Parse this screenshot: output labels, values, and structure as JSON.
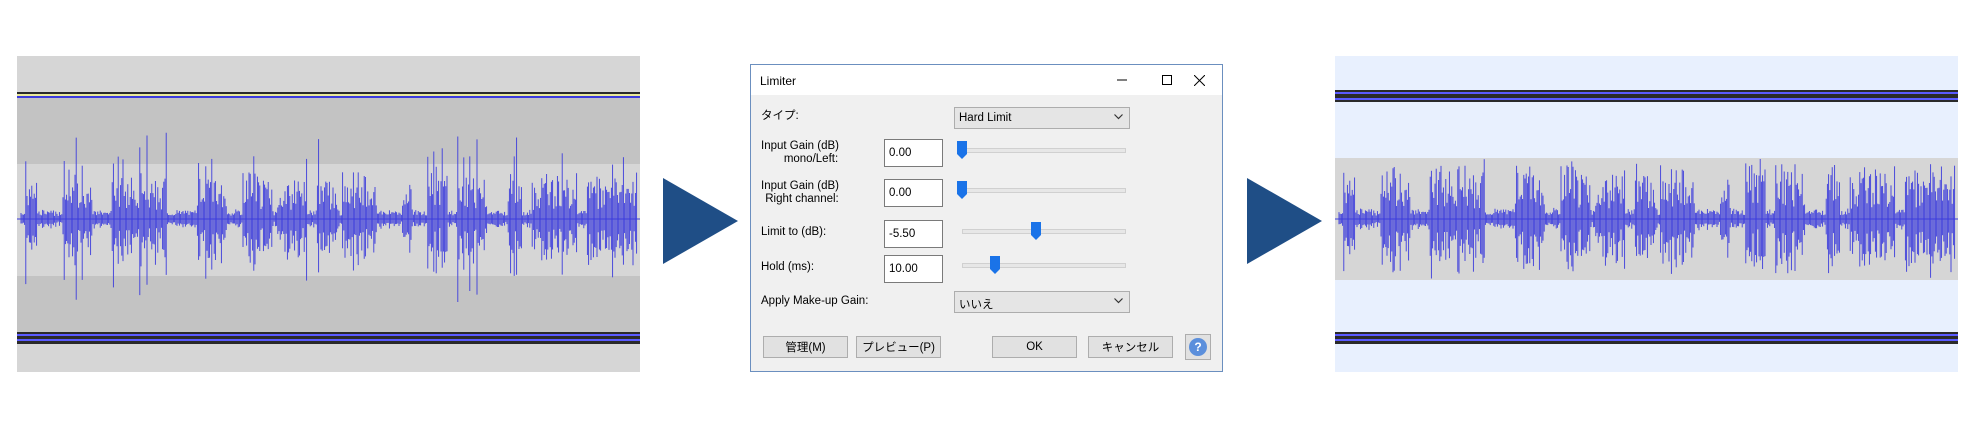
{
  "colors": {
    "waveform": "#3c3cdc",
    "arrow": "#1f4e86",
    "track_bg_original": "#d6d6d6",
    "track_band_original": "#c3c3c3",
    "track_bg_processed": "#e8f0fe",
    "track_band_processed": "#d6d6d6",
    "slider_thumb": "#1a73e8"
  },
  "icons": {
    "arrow": "triangle-right",
    "minimize": "minimize-icon",
    "maximize": "maximize-icon",
    "close": "close-icon",
    "help": "help-icon"
  },
  "dialog": {
    "title": "Limiter",
    "type_label": "タイプ:",
    "type_value": "Hard Limit",
    "input_gain_left_label_line1": "Input Gain (dB)",
    "input_gain_left_label_line2": "mono/Left:",
    "input_gain_left_value": "0.00",
    "input_gain_left_level": 0.0,
    "input_gain_right_label_line1": "Input Gain (dB)",
    "input_gain_right_label_line2": "Right channel:",
    "input_gain_right_value": "0.00",
    "input_gain_right_level": 0.0,
    "limit_label": "Limit to (dB):",
    "limit_value": "-5.50",
    "limit_level": 0.45,
    "hold_label": "Hold (ms):",
    "hold_value": "10.00",
    "hold_level": 0.2,
    "makeup_label": "Apply Make-up Gain:",
    "makeup_value": "いいえ",
    "buttons": {
      "manage": "管理(M)",
      "preview": "プレビュー(P)",
      "ok": "OK",
      "cancel": "キャンセル",
      "help": "?"
    }
  }
}
